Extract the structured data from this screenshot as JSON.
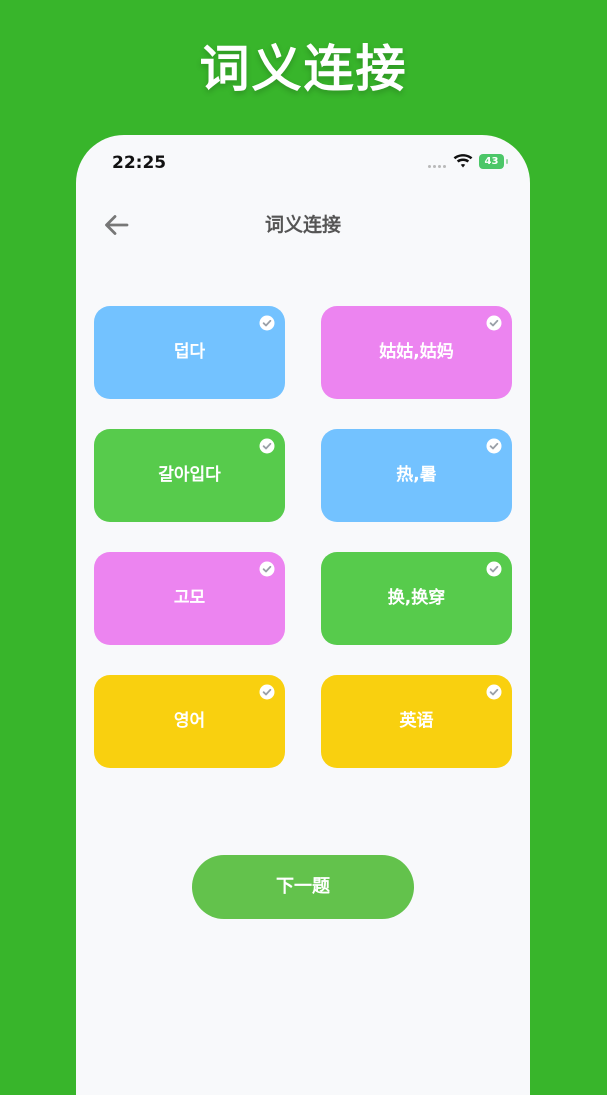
{
  "header": {
    "title": "词义连接"
  },
  "status_bar": {
    "time": "22:25",
    "battery": "43"
  },
  "nav": {
    "title": "词义连接",
    "back_icon": "arrow-left-icon"
  },
  "cards": [
    {
      "label": "덥다",
      "color": "#73c2ff",
      "state": "checked"
    },
    {
      "label": "姑姑,姑妈",
      "color": "#ec84f0",
      "state": "checked"
    },
    {
      "label": "갈아입다",
      "color": "#57cb4c",
      "state": "checked"
    },
    {
      "label": "热,暑",
      "color": "#73c2ff",
      "state": "checked"
    },
    {
      "label": "고모",
      "color": "#ec84f0",
      "state": "checked"
    },
    {
      "label": "换,换穿",
      "color": "#57cb4c",
      "state": "checked"
    },
    {
      "label": "영어",
      "color": "#f9d00f",
      "state": "checked"
    },
    {
      "label": "英语",
      "color": "#f9d00f",
      "state": "checked"
    }
  ],
  "next_button": {
    "label": "下一题",
    "color": "#63c24c"
  },
  "colors": {
    "background": "#38b52b",
    "screen": "#f8f9fb",
    "title_text": "#555555"
  }
}
